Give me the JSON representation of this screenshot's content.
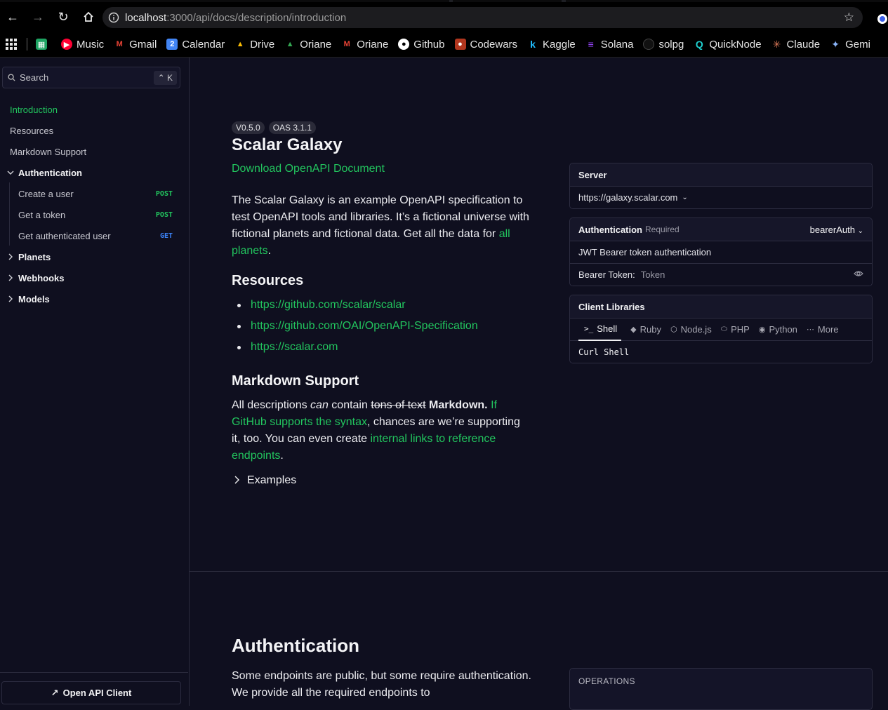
{
  "browser": {
    "url_host": "localhost",
    "url_path": ":3000/api/docs/description/introduction",
    "bookmarks": [
      {
        "label": "",
        "icon": "sheets-icon",
        "color": "#1fa463"
      },
      {
        "label": "Music",
        "icon": "music-icon",
        "color": "#ff0033"
      },
      {
        "label": "Gmail",
        "icon": "gmail-icon",
        "color": "#ea4335"
      },
      {
        "label": "Calendar",
        "icon": "calendar-icon",
        "color": "#4285f4"
      },
      {
        "label": "Drive",
        "icon": "drive-icon",
        "color": "#fbbc04"
      },
      {
        "label": "Oriane",
        "icon": "drive-icon",
        "color": "#34a853"
      },
      {
        "label": "Oriane",
        "icon": "gmail-icon",
        "color": "#ea4335"
      },
      {
        "label": "Github",
        "icon": "github-icon",
        "color": "#ffffff"
      },
      {
        "label": "Codewars",
        "icon": "codewars-icon",
        "color": "#b1361e"
      },
      {
        "label": "Kaggle",
        "icon": "kaggle-icon",
        "color": "#20beff"
      },
      {
        "label": "Solana",
        "icon": "solana-icon",
        "color": "#9945ff"
      },
      {
        "label": "solpg",
        "icon": "solpg-icon",
        "color": "#111111"
      },
      {
        "label": "QuickNode",
        "icon": "quicknode-icon",
        "color": "#1fd1d1"
      },
      {
        "label": "Claude",
        "icon": "claude-icon",
        "color": "#d97757"
      },
      {
        "label": "Gemi",
        "icon": "gemini-icon",
        "color": "#8ab4f8"
      }
    ]
  },
  "sidebar": {
    "search_placeholder": "Search",
    "search_shortcut": "⌃ K",
    "items": [
      {
        "label": "Introduction"
      },
      {
        "label": "Resources"
      },
      {
        "label": "Markdown Support"
      },
      {
        "label": "Authentication"
      },
      {
        "label": "Create a user",
        "method": "POST"
      },
      {
        "label": "Get a token",
        "method": "POST"
      },
      {
        "label": "Get authenticated user",
        "method": "GET"
      },
      {
        "label": "Planets"
      },
      {
        "label": "Webhooks"
      },
      {
        "label": "Models"
      }
    ],
    "footer_label": "Open API Client"
  },
  "main": {
    "version_badge": "V0.5.0",
    "oas_badge": "OAS 3.1.1",
    "title": "Scalar Galaxy",
    "download_link": "Download OpenAPI Document",
    "intro_text": "The Scalar Galaxy is an example OpenAPI specification to test OpenAPI tools and libraries. It’s a fictional universe with fictional planets and fictional data. Get all the data for ",
    "intro_link": "all planets",
    "intro_end": ".",
    "resources_heading": "Resources",
    "resources": [
      "https://github.com/scalar/scalar",
      "https://github.com/OAI/OpenAPI-Specification",
      "https://scalar.com"
    ],
    "markdown_heading": "Markdown Support",
    "md_1": "All descriptions ",
    "md_em": "can",
    "md_2": " contain ",
    "md_strike": "tons of text",
    "md_3": " ",
    "md_bold": "Markdown.",
    "md_4": " ",
    "md_link1": "If GitHub supports the syntax",
    "md_5": ", chances are we’re supporting it, too. You can even create ",
    "md_link2": "internal links to reference endpoints",
    "md_6": ".",
    "examples_label": "Examples",
    "auth_heading": "Authentication",
    "auth_text": "Some endpoints are public, but some require authentication. We provide all the required endpoints to"
  },
  "server_card": {
    "heading": "Server",
    "url": "https://galaxy.scalar.com"
  },
  "auth_card": {
    "heading": "Authentication",
    "required": "Required",
    "scheme": "bearerAuth",
    "description": "JWT Bearer token authentication",
    "token_label": "Bearer Token:",
    "token_placeholder": "Token"
  },
  "client_card": {
    "heading": "Client Libraries",
    "tabs": [
      "Shell",
      "Ruby",
      "Node.js",
      "PHP",
      "Python",
      "More"
    ],
    "code": "Curl Shell"
  },
  "ops_card": {
    "heading": "OPERATIONS"
  },
  "colors": {
    "accent": "#22c55e",
    "post": "#22c55e",
    "get": "#3b82f6",
    "background": "#0f0f1f"
  }
}
